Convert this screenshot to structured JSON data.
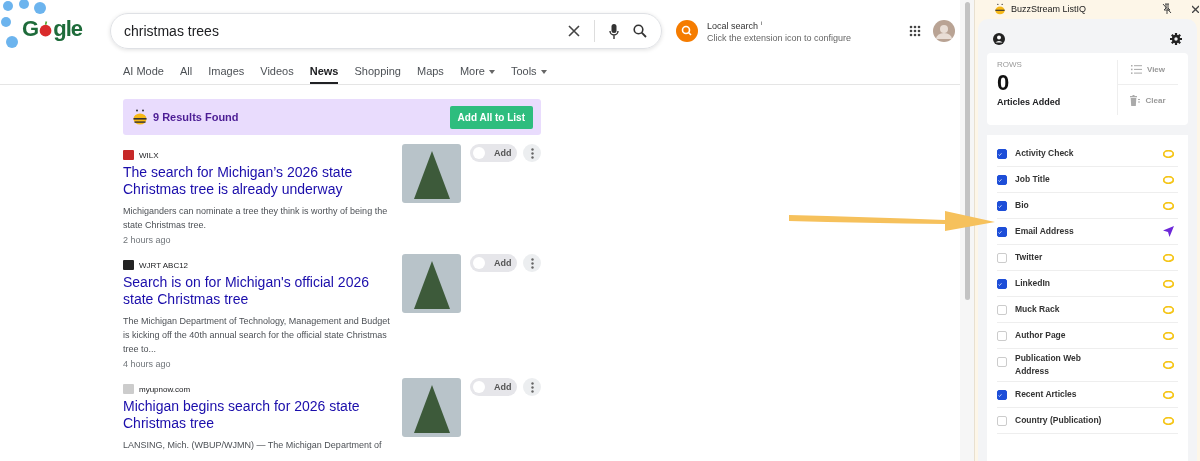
{
  "logo": {
    "parts": [
      "G",
      "gle"
    ]
  },
  "search": {
    "value": "christmas trees"
  },
  "local_search": {
    "title": "Local search",
    "info": "i",
    "hint": "Click the extension icon to configure"
  },
  "tabs": [
    {
      "label": "AI Mode",
      "selected": false,
      "dropdown": false
    },
    {
      "label": "All",
      "selected": false,
      "dropdown": false
    },
    {
      "label": "Images",
      "selected": false,
      "dropdown": false
    },
    {
      "label": "Videos",
      "selected": false,
      "dropdown": false
    },
    {
      "label": "News",
      "selected": true,
      "dropdown": false
    },
    {
      "label": "Shopping",
      "selected": false,
      "dropdown": false
    },
    {
      "label": "Maps",
      "selected": false,
      "dropdown": false
    },
    {
      "label": "More",
      "selected": false,
      "dropdown": true
    },
    {
      "label": "Tools",
      "selected": false,
      "dropdown": true
    }
  ],
  "results_banner": {
    "text": "9 Results Found",
    "button": "Add All to List"
  },
  "articles": [
    {
      "source": "WILX",
      "title": "The search for Michigan’s 2026 state Christmas tree is already underway",
      "snippet": "Michiganders can nominate a tree they think is worthy of being the state Christmas tree.",
      "time": "2 hours ago",
      "add_label": "Add",
      "added": false
    },
    {
      "source": "WJRT ABC12",
      "title": "Search is on for Michigan's official 2026 state Christmas tree",
      "snippet": "The Michigan Department of Technology, Management and Budget is kicking off the 40th annual search for the official state Christmas tree to...",
      "time": "4 hours ago",
      "add_label": "Add",
      "added": false
    },
    {
      "source": "myupnow.com",
      "title": "Michigan begins search for 2026 state Christmas tree",
      "snippet": "LANSING, Mich. (WBUP/WJMN) — The Michigan Department of",
      "add_label": "Add",
      "added": false
    }
  ],
  "panel": {
    "title": "BuzzStream ListIQ",
    "stats": {
      "caption": "ROWS",
      "count": "0",
      "label": "Articles Added",
      "view": "View",
      "clear": "Clear"
    },
    "fields": [
      {
        "label": "Activity Check",
        "checked": true,
        "kind": "coin"
      },
      {
        "label": "Job Title",
        "checked": true,
        "kind": "coin"
      },
      {
        "label": "Bio",
        "checked": true,
        "kind": "coin"
      },
      {
        "label": "Email Address",
        "checked": true,
        "kind": "send"
      },
      {
        "label": "Twitter",
        "checked": false,
        "kind": "coin"
      },
      {
        "label": "LinkedIn",
        "checked": true,
        "kind": "coin"
      },
      {
        "label": "Muck Rack",
        "checked": false,
        "kind": "coin"
      },
      {
        "label": "Author Page",
        "checked": false,
        "kind": "coin"
      },
      {
        "label": "Publication Web Address",
        "checked": false,
        "kind": "coin"
      },
      {
        "label": "Recent Articles",
        "checked": true,
        "kind": "coin"
      },
      {
        "label": "Country (Publication)",
        "checked": false,
        "kind": "coin"
      }
    ]
  }
}
